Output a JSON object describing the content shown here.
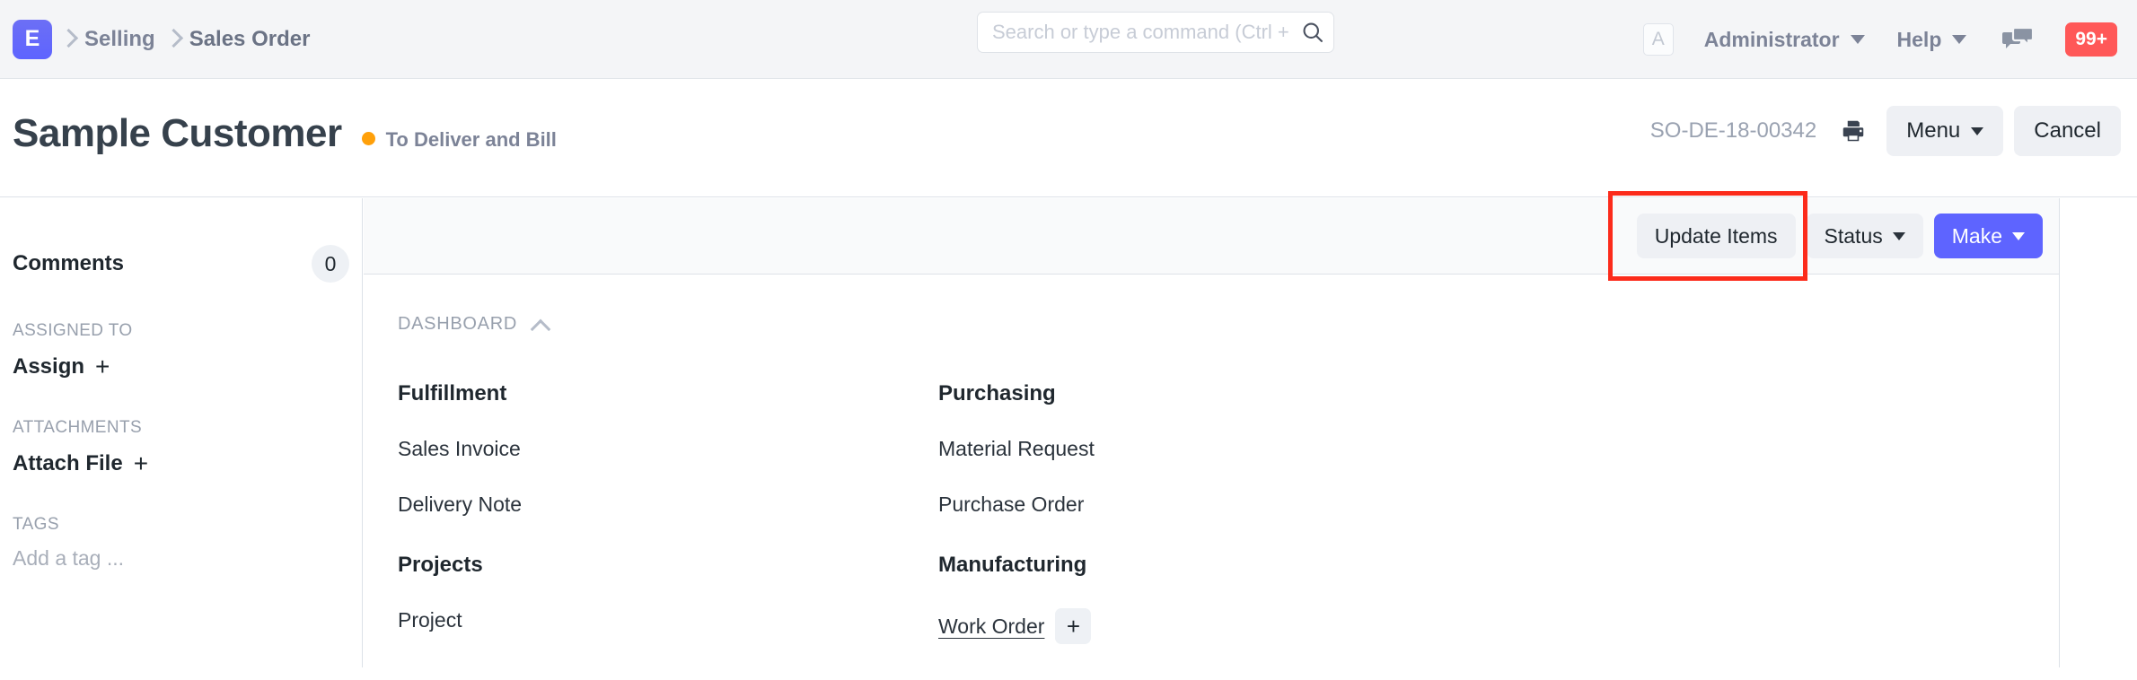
{
  "navbar": {
    "logo_letter": "E",
    "breadcrumbs": [
      {
        "label": "Selling"
      },
      {
        "label": "Sales Order"
      }
    ],
    "search": {
      "placeholder": "Search or type a command (Ctrl + G)",
      "value": "",
      "icon": "search-icon"
    },
    "avatar_letter": "A",
    "user_label": "Administrator",
    "help_label": "Help",
    "chat_icon": "chat-bubbles-icon",
    "notification_badge": "99+",
    "notification_color": "#ff5858",
    "brand_color": "#5e64ff"
  },
  "header": {
    "title": "Sample Customer",
    "status_text": "To Deliver and Bill",
    "status_color": "#ffa00a",
    "doc_id": "SO-DE-18-00342",
    "print_icon": "printer-icon",
    "menu_label": "Menu",
    "cancel_label": "Cancel"
  },
  "sidebar": {
    "comments_label": "Comments",
    "comments_count": "0",
    "assigned_to_label": "ASSIGNED TO",
    "assign_label": "Assign",
    "attachments_label": "ATTACHMENTS",
    "attach_file_label": "Attach File",
    "tags_label": "TAGS",
    "tag_placeholder": "Add a tag ...",
    "plus_glyph": "+"
  },
  "toolbar": {
    "update_items_label": "Update Items",
    "status_label": "Status",
    "make_label": "Make",
    "primary_color": "#5e64ff",
    "highlight_color": "#fc2b1b"
  },
  "dashboard": {
    "section_title": "DASHBOARD",
    "collapse_icon": "chevron-up-icon",
    "groups": [
      {
        "title": "Fulfillment",
        "column": "left",
        "links": [
          {
            "label": "Sales Invoice",
            "has_add": false
          },
          {
            "label": "Delivery Note",
            "has_add": false
          }
        ]
      },
      {
        "title": "Purchasing",
        "column": "right",
        "links": [
          {
            "label": "Material Request",
            "has_add": false
          },
          {
            "label": "Purchase Order",
            "has_add": false
          }
        ]
      },
      {
        "title": "Projects",
        "column": "left",
        "links": [
          {
            "label": "Project",
            "has_add": false
          }
        ]
      },
      {
        "title": "Manufacturing",
        "column": "right",
        "links": [
          {
            "label": "Work Order",
            "has_add": true,
            "add_glyph": "+"
          }
        ]
      }
    ]
  }
}
